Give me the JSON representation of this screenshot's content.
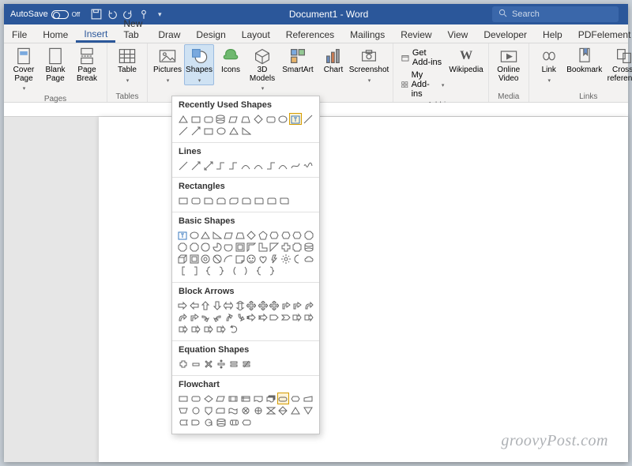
{
  "titlebar": {
    "autosave_label": "AutoSave",
    "autosave_state": "Off",
    "title": "Document1 - Word",
    "search_placeholder": "Search"
  },
  "tabs": {
    "file": "File",
    "home": "Home",
    "insert": "Insert",
    "newtab": "New Tab",
    "draw": "Draw",
    "design": "Design",
    "layout": "Layout",
    "references": "References",
    "mailings": "Mailings",
    "review": "Review",
    "view": "View",
    "developer": "Developer",
    "help": "Help",
    "pdfelement": "PDFelement"
  },
  "ribbon": {
    "pages": {
      "label": "Pages",
      "cover": "Cover\nPage",
      "blank": "Blank\nPage",
      "break": "Page\nBreak"
    },
    "tables": {
      "label": "Tables",
      "table": "Table"
    },
    "illustrations": {
      "pictures": "Pictures",
      "shapes": "Shapes",
      "icons": "Icons",
      "models": "3D\nModels",
      "smartart": "SmartArt",
      "chart": "Chart",
      "screenshot": "Screenshot"
    },
    "addins": {
      "label": "Add-ins",
      "get": "Get Add-ins",
      "my": "My Add-ins",
      "wikipedia": "Wikipedia"
    },
    "media": {
      "label": "Media",
      "video": "Online\nVideo"
    },
    "links": {
      "label": "Links",
      "link": "Link",
      "bookmark": "Bookmark",
      "cross": "Cross-\nreference"
    }
  },
  "shapes_panel": {
    "recently": "Recently Used Shapes",
    "lines": "Lines",
    "rectangles": "Rectangles",
    "basic": "Basic Shapes",
    "block": "Block Arrows",
    "equation": "Equation Shapes",
    "flowchart": "Flowchart"
  },
  "watermark": "groovyPost.com"
}
